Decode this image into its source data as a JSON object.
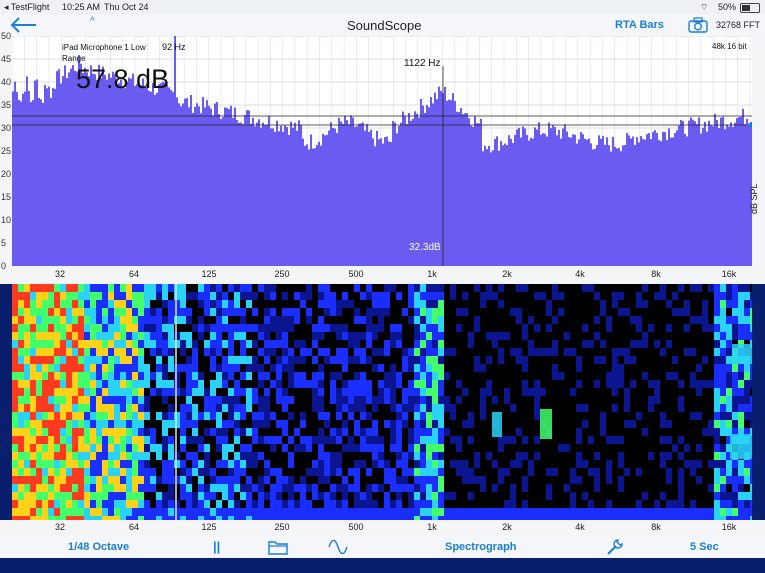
{
  "status": {
    "carrier": "◂ TestFlight",
    "time": "10:25 AM",
    "date": "Thu Oct 24",
    "battery": "50%"
  },
  "nav": {
    "title": "SoundScope",
    "mode": "RTA Bars",
    "fft": "32768 FFT"
  },
  "rta": {
    "y_ticks": [
      "50",
      "45",
      "40",
      "35",
      "30",
      "25",
      "20",
      "15",
      "10",
      "5",
      "0"
    ],
    "x_ticks": [
      "32",
      "64",
      "125",
      "250",
      "500",
      "1k",
      "2k",
      "4k",
      "8k",
      "16k"
    ],
    "device": "iPad Microphone 1 Low Range",
    "peak_hz": "92 Hz",
    "level": "57.8 dB",
    "mid_peak": "1122 Hz",
    "avg": "32.3dB",
    "rate": "48k 16 bit",
    "side": "dB SPL"
  },
  "spec": {
    "x_ticks": [
      "32",
      "64",
      "125",
      "250",
      "500",
      "1k",
      "2k",
      "4k",
      "8k",
      "16k"
    ]
  },
  "toolbar": {
    "resolution": "1/48 Octave",
    "pause": "||",
    "view": "Spectrograph",
    "duration": "5 Sec"
  },
  "colors": {
    "bars": "#6a5cf0",
    "spec_blue": "#1a2fff",
    "spec_cyan": "#2ad3f5",
    "accent": "#1a7fd4"
  }
}
